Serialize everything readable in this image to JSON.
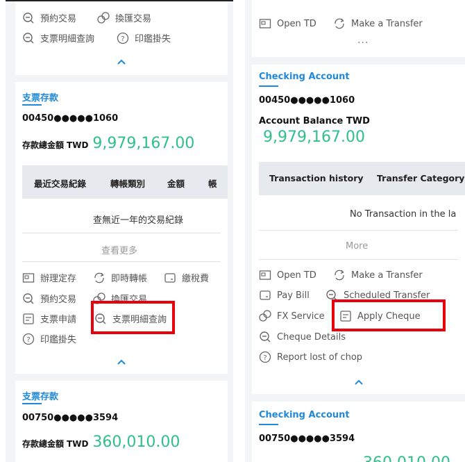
{
  "left": {
    "top_card": {
      "actions": [
        {
          "label": "預約交易",
          "icon": "search-icon"
        },
        {
          "label": "換匯交易",
          "icon": "fx-exchange-icon"
        },
        {
          "label": "支票明細查詢",
          "icon": "search-icon"
        },
        {
          "label": "印鑑掛失",
          "icon": "question-circle-icon"
        }
      ]
    },
    "card1": {
      "title": "支票存款",
      "account_number": "00450●●●●●1060",
      "balance_label": "存款總金額",
      "currency": "TWD",
      "balance": "9,979,167.00",
      "table_headers": [
        "最近交易紀錄",
        "轉帳類別",
        "金額",
        "帳"
      ],
      "empty_message": "查無近一年的交易紀錄",
      "more_label": "查看更多",
      "actions": [
        {
          "label": "辦理定存",
          "icon": "deposit-icon"
        },
        {
          "label": "即時轉帳",
          "icon": "transfer-icon"
        },
        {
          "label": "繳稅費",
          "icon": "bill-icon"
        },
        {
          "label": "預約交易",
          "icon": "search-icon"
        },
        {
          "label": "換匯交易",
          "icon": "fx-exchange-icon"
        },
        {
          "label": "支票申請",
          "icon": "cheque-icon"
        },
        {
          "label": "支票明細查詢",
          "icon": "search-icon"
        },
        {
          "label": "印鑑掛失",
          "icon": "question-circle-icon"
        }
      ]
    },
    "card2": {
      "title": "支票存款",
      "account_number": "00750●●●●●3594",
      "balance_label": "存款總金額",
      "currency": "TWD",
      "balance": "360,010.00"
    }
  },
  "right": {
    "top_card": {
      "actions": [
        {
          "label": "Open TD",
          "icon": "deposit-icon"
        },
        {
          "label": "Make a Transfer",
          "icon": "transfer-icon"
        }
      ],
      "overflow": "..."
    },
    "card1": {
      "title": "Checking Account",
      "account_number": "00450●●●●●1060",
      "balance_label": "Account Balance TWD",
      "balance": "9,979,167.00",
      "table_headers": [
        "Transaction history",
        "Transfer Category"
      ],
      "empty_message": "No Transaction in the la",
      "more_label": "More",
      "actions": [
        {
          "label": "Open TD",
          "icon": "deposit-icon"
        },
        {
          "label": "Make a Transfer",
          "icon": "transfer-icon"
        },
        {
          "label": "Pay Bill",
          "icon": "bill-icon"
        },
        {
          "label": "Scheduled Transfer",
          "icon": "search-icon"
        },
        {
          "label": "FX Service",
          "icon": "fx-exchange-icon"
        },
        {
          "label": "Apply Cheque",
          "icon": "cheque-icon"
        },
        {
          "label": "Cheque Details",
          "icon": "search-icon"
        },
        {
          "label": "Report lost of chop",
          "icon": "question-circle-icon"
        }
      ]
    },
    "card2": {
      "title": "Checking Account",
      "account_number": "00750●●●●●3594",
      "balance_partial": "360,010.00"
    }
  },
  "colors": {
    "accent_blue": "#1f88d9",
    "balance_green": "#2fbf8a",
    "highlight_red": "#e8000b",
    "panel_bg": "#f3f4f6",
    "table_header_bg": "#e6e9ee"
  }
}
